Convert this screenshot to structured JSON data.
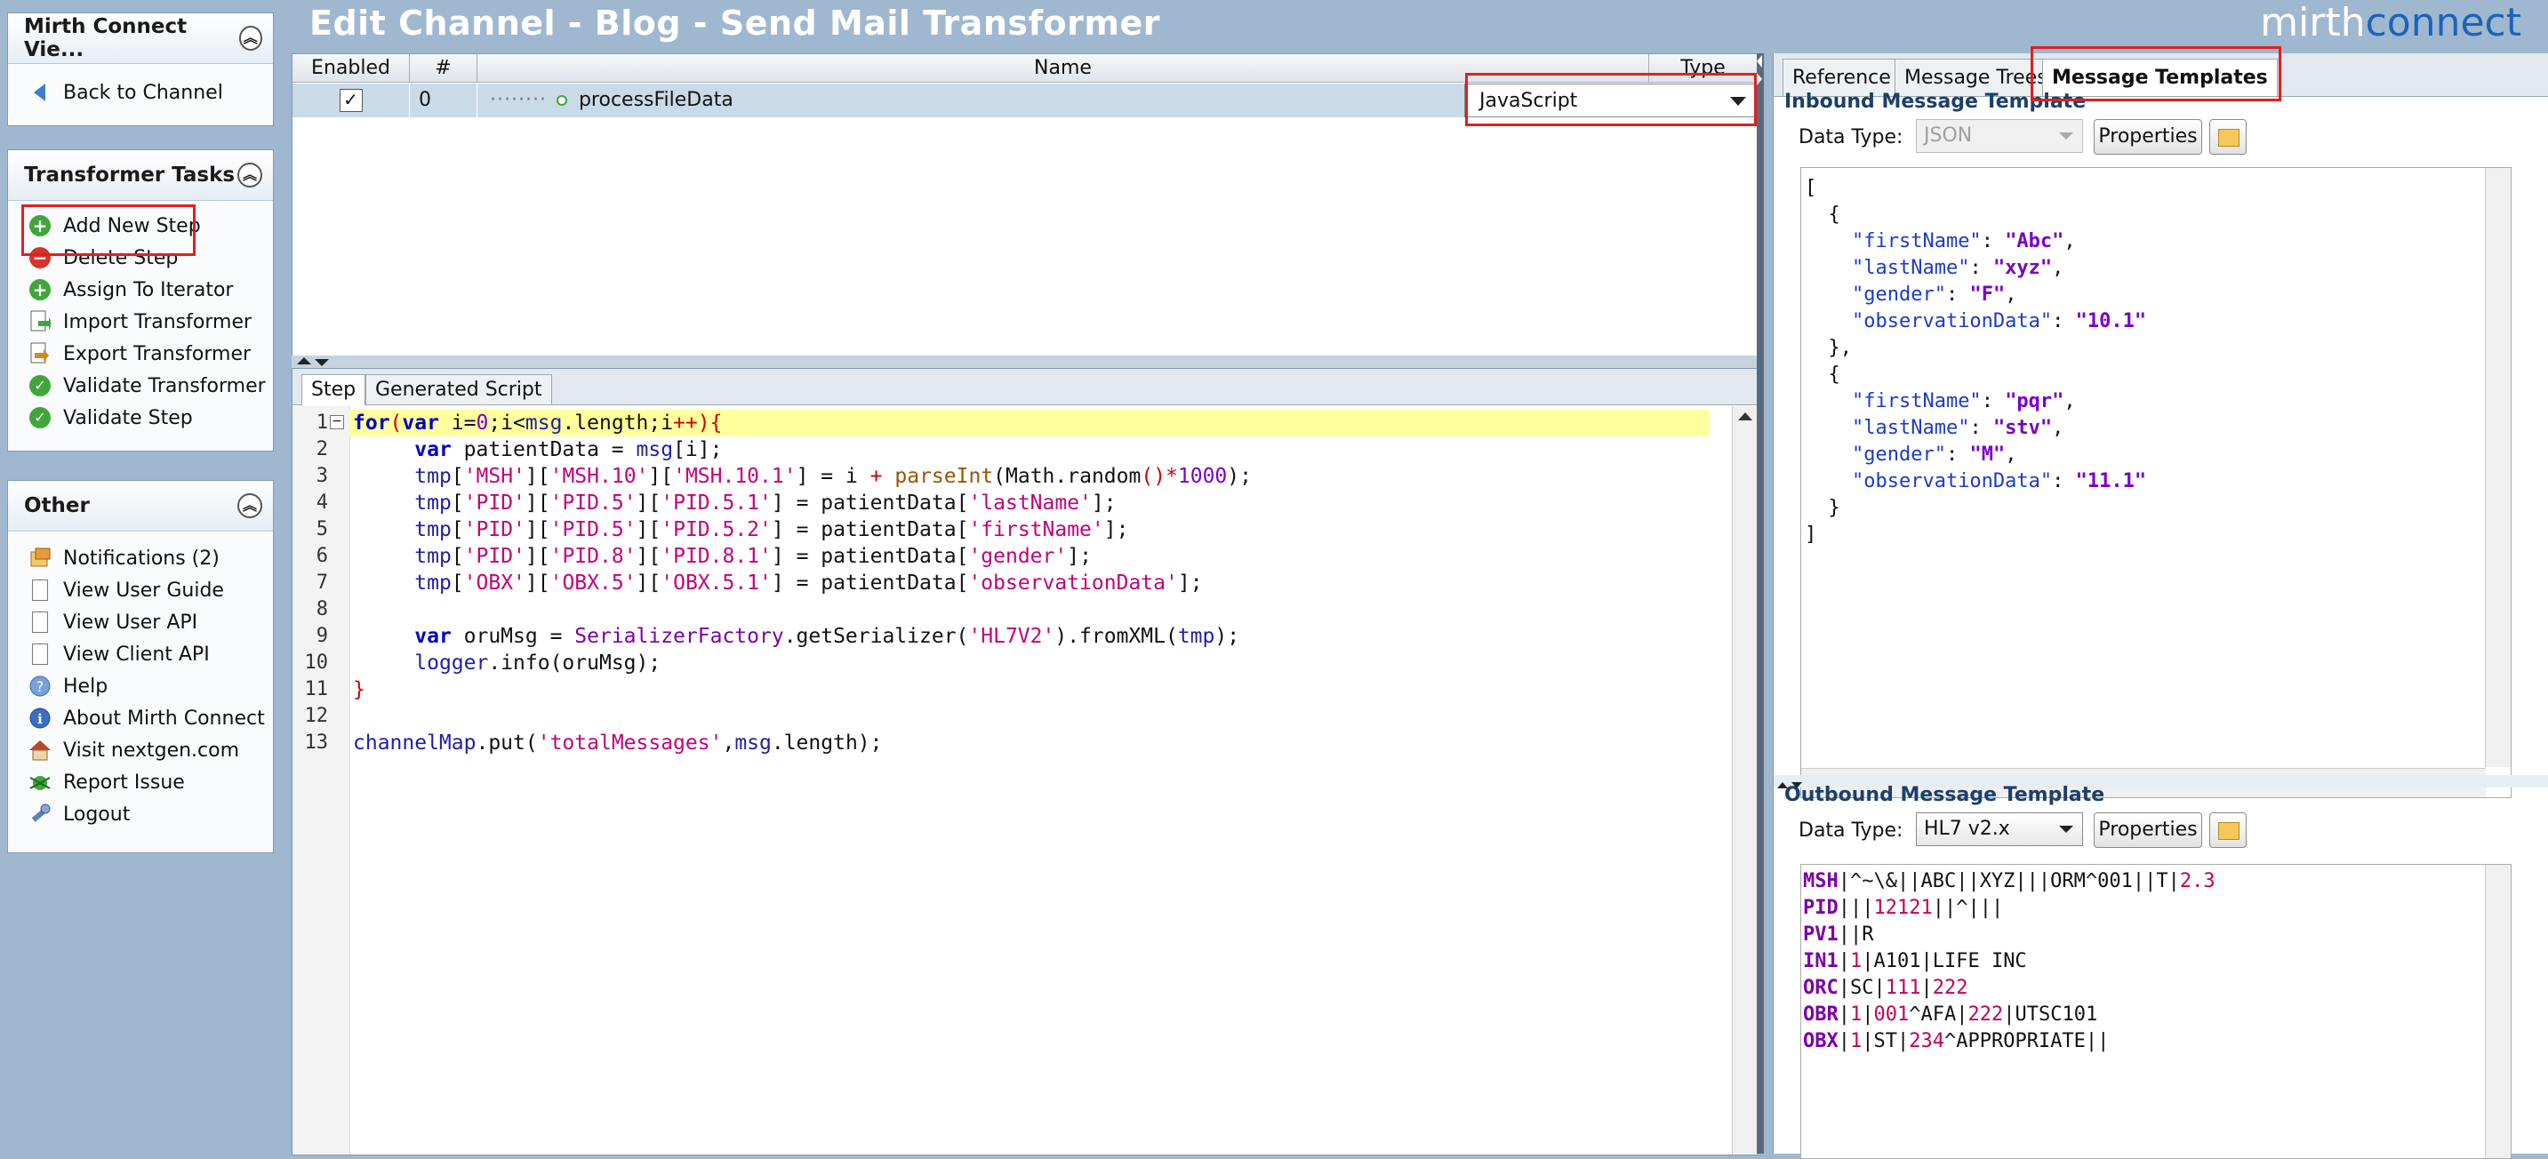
{
  "window": {
    "title": "Edit Channel - Blog - Send Mail Transformer",
    "logo": "mirthconnect",
    "logo_prefix": "mirth",
    "logo_suffix": "connect"
  },
  "sidebar": {
    "nav_panel": {
      "title": "Mirth Connect Vie...",
      "back": "Back to Channel"
    },
    "tasks_panel": {
      "title": "Transformer Tasks",
      "items": [
        {
          "label": "Add New Step",
          "icon": "add-icon"
        },
        {
          "label": "Delete Step",
          "icon": "delete-icon"
        },
        {
          "label": "Assign To Iterator",
          "icon": "add-icon"
        },
        {
          "label": "Import Transformer",
          "icon": "import-icon"
        },
        {
          "label": "Export Transformer",
          "icon": "export-icon"
        },
        {
          "label": "Validate Transformer",
          "icon": "check-icon"
        },
        {
          "label": "Validate Step",
          "icon": "check-icon"
        }
      ]
    },
    "other_panel": {
      "title": "Other",
      "items": [
        {
          "label": "Notifications (2)",
          "icon": "notification-icon"
        },
        {
          "label": "View User Guide",
          "icon": "document-icon"
        },
        {
          "label": "View User API",
          "icon": "document-icon"
        },
        {
          "label": "View Client API",
          "icon": "document-icon"
        },
        {
          "label": "Help",
          "icon": "help-icon"
        },
        {
          "label": "About Mirth Connect",
          "icon": "info-icon"
        },
        {
          "label": "Visit nextgen.com",
          "icon": "home-icon"
        },
        {
          "label": "Report Issue",
          "icon": "bug-icon"
        },
        {
          "label": "Logout",
          "icon": "logout-icon"
        }
      ]
    }
  },
  "steps_table": {
    "headers": {
      "enabled": "Enabled",
      "number": "#",
      "name": "Name",
      "type": "Type"
    },
    "rows": [
      {
        "enabled": true,
        "number": "0",
        "name": "processFileData",
        "type": "JavaScript"
      }
    ]
  },
  "editor": {
    "tabs": [
      "Step",
      "Generated Script"
    ],
    "line_numbers": [
      "1",
      "2",
      "3",
      "4",
      "5",
      "6",
      "7",
      "8",
      "9",
      "10",
      "11",
      "12",
      "13"
    ]
  },
  "right_panel": {
    "tabs": [
      "Reference",
      "Message Trees",
      "Message Templates"
    ],
    "inbound": {
      "title": "Inbound Message Template",
      "data_type_label": "Data Type:",
      "data_type": "JSON",
      "properties_label": "Properties"
    },
    "outbound": {
      "title": "Outbound Message Template",
      "data_type_label": "Data Type:",
      "data_type": "HL7 v2.x",
      "properties_label": "Properties"
    }
  },
  "colors": {
    "background": "#9fb8cf",
    "highlight_box": "#e02020",
    "current_line": "#ffff9e",
    "keyword": "#0000c8",
    "string": "#c4007a"
  }
}
